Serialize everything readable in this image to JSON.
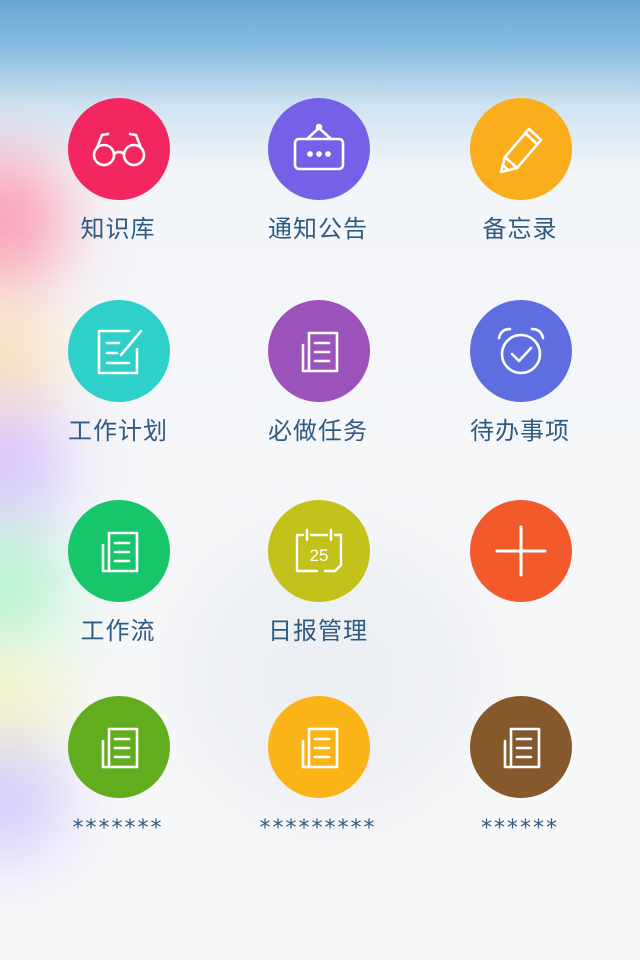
{
  "colors": {
    "label_text": "#2f5b82",
    "knowledge": "#f2275f",
    "notice": "#7461e8",
    "memo": "#fbae1c",
    "work_plan": "#2fd0c9",
    "must_do": "#9b52ba",
    "todo": "#5e6ee0",
    "workflow": "#17c56a",
    "daily_report": "#c3c21b",
    "add": "#f25a2c",
    "extra1": "#62ad1e",
    "extra2": "#fbb418",
    "extra3": "#86592d"
  },
  "tiles": [
    {
      "label": "知识库",
      "icon": "glasses-icon"
    },
    {
      "label": "通知公告",
      "icon": "signboard-icon"
    },
    {
      "label": "备忘录",
      "icon": "pencil-icon"
    },
    {
      "label": "工作计划",
      "icon": "edit-note-icon"
    },
    {
      "label": "必做任务",
      "icon": "document-icon"
    },
    {
      "label": "待办事项",
      "icon": "alarm-clock-icon"
    },
    {
      "label": "工作流",
      "icon": "document-icon"
    },
    {
      "label": "日报管理",
      "icon": "calendar-icon",
      "calendar_day": "25"
    },
    {
      "label": "",
      "icon": "plus-icon"
    },
    {
      "label": "*******",
      "icon": "document-icon"
    },
    {
      "label": "*********",
      "icon": "document-icon"
    },
    {
      "label": "******",
      "icon": "document-icon"
    }
  ]
}
